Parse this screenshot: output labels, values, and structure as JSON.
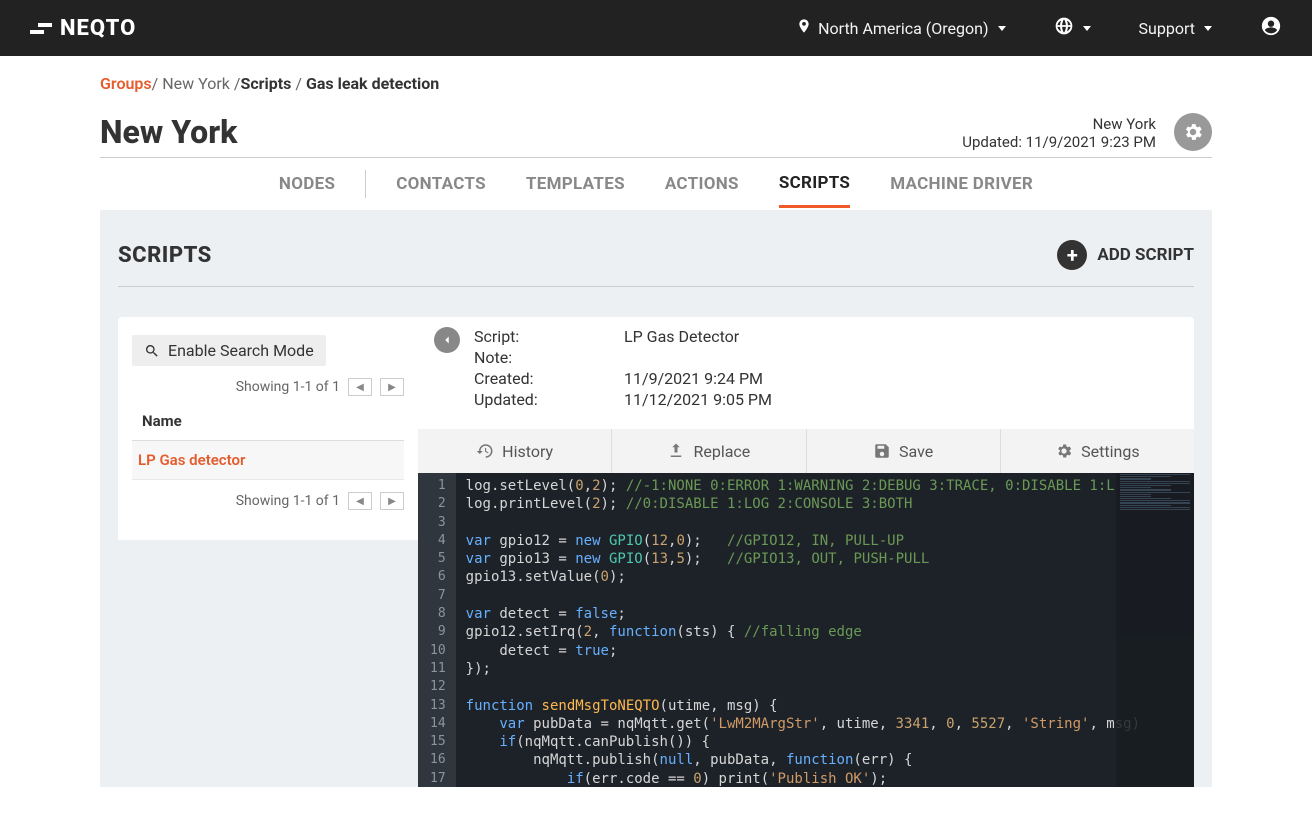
{
  "topbar": {
    "logo": "NEQTO",
    "region": "North America (Oregon)",
    "support": "Support"
  },
  "breadcrumb": {
    "groups": "Groups",
    "group": "New York",
    "scripts": "Scripts",
    "current": "Gas leak detection"
  },
  "header": {
    "title": "New York",
    "meta_name": "New York",
    "meta_updated": "Updated: 11/9/2021 9:23 PM"
  },
  "tabs": {
    "nodes": "NODES",
    "contacts": "CONTACTS",
    "templates": "TEMPLATES",
    "actions": "ACTIONS",
    "scripts": "SCRIPTS",
    "machine_driver": "MACHINE DRIVER"
  },
  "section": {
    "title": "SCRIPTS",
    "add": "ADD SCRIPT"
  },
  "left": {
    "search": "Enable Search Mode",
    "pager_top": "Showing 1-1 of 1",
    "col_name": "Name",
    "item1": "LP Gas detector",
    "pager_bottom": "Showing 1-1 of 1"
  },
  "detail": {
    "k_script": "Script:",
    "v_script": "LP Gas Detector",
    "k_note": "Note:",
    "v_note": "",
    "k_created": "Created:",
    "v_created": "11/9/2021 9:24 PM",
    "k_updated": "Updated:",
    "v_updated": "11/12/2021 9:05 PM"
  },
  "toolbar": {
    "history": "History",
    "replace": "Replace",
    "save": "Save",
    "settings": "Settings"
  },
  "code": {
    "lines": [
      {
        "n": "1",
        "seg": [
          {
            "t": "log.setLevel(",
            "c": "c-plain"
          },
          {
            "t": "0",
            "c": "c-num"
          },
          {
            "t": ",",
            "c": "c-plain"
          },
          {
            "t": "2",
            "c": "c-num"
          },
          {
            "t": "); ",
            "c": "c-plain"
          },
          {
            "t": "//-1:NONE 0:ERROR 1:WARNING 2:DEBUG 3:TRACE, 0:DISABLE 1:L",
            "c": "c-cmt"
          }
        ]
      },
      {
        "n": "2",
        "seg": [
          {
            "t": "log.printLevel(",
            "c": "c-plain"
          },
          {
            "t": "2",
            "c": "c-num"
          },
          {
            "t": "); ",
            "c": "c-plain"
          },
          {
            "t": "//0:DISABLE 1:LOG 2:CONSOLE 3:BOTH",
            "c": "c-cmt"
          }
        ]
      },
      {
        "n": "3",
        "seg": []
      },
      {
        "n": "4",
        "seg": [
          {
            "t": "var",
            "c": "c-kw"
          },
          {
            "t": " gpio12 = ",
            "c": "c-plain"
          },
          {
            "t": "new",
            "c": "c-kw"
          },
          {
            "t": " ",
            "c": "c-plain"
          },
          {
            "t": "GPIO",
            "c": "c-type"
          },
          {
            "t": "(",
            "c": "c-plain"
          },
          {
            "t": "12",
            "c": "c-num"
          },
          {
            "t": ",",
            "c": "c-plain"
          },
          {
            "t": "0",
            "c": "c-num"
          },
          {
            "t": ");   ",
            "c": "c-plain"
          },
          {
            "t": "//GPIO12, IN, PULL-UP",
            "c": "c-cmt"
          }
        ]
      },
      {
        "n": "5",
        "seg": [
          {
            "t": "var",
            "c": "c-kw"
          },
          {
            "t": " gpio13 = ",
            "c": "c-plain"
          },
          {
            "t": "new",
            "c": "c-kw"
          },
          {
            "t": " ",
            "c": "c-plain"
          },
          {
            "t": "GPIO",
            "c": "c-type"
          },
          {
            "t": "(",
            "c": "c-plain"
          },
          {
            "t": "13",
            "c": "c-num"
          },
          {
            "t": ",",
            "c": "c-plain"
          },
          {
            "t": "5",
            "c": "c-num"
          },
          {
            "t": ");   ",
            "c": "c-plain"
          },
          {
            "t": "//GPIO13, OUT, PUSH-PULL",
            "c": "c-cmt"
          }
        ]
      },
      {
        "n": "6",
        "seg": [
          {
            "t": "gpio13.setValue(",
            "c": "c-plain"
          },
          {
            "t": "0",
            "c": "c-num"
          },
          {
            "t": ");",
            "c": "c-plain"
          }
        ]
      },
      {
        "n": "7",
        "seg": []
      },
      {
        "n": "8",
        "seg": [
          {
            "t": "var",
            "c": "c-kw"
          },
          {
            "t": " detect = ",
            "c": "c-plain"
          },
          {
            "t": "false",
            "c": "c-bool"
          },
          {
            "t": ";",
            "c": "c-plain"
          }
        ]
      },
      {
        "n": "9",
        "seg": [
          {
            "t": "gpio12.setIrq(",
            "c": "c-plain"
          },
          {
            "t": "2",
            "c": "c-num"
          },
          {
            "t": ", ",
            "c": "c-plain"
          },
          {
            "t": "function",
            "c": "c-kw"
          },
          {
            "t": "(sts) { ",
            "c": "c-plain"
          },
          {
            "t": "//falling edge",
            "c": "c-cmt"
          }
        ]
      },
      {
        "n": "10",
        "seg": [
          {
            "t": "    detect = ",
            "c": "c-plain"
          },
          {
            "t": "true",
            "c": "c-bool"
          },
          {
            "t": ";",
            "c": "c-plain"
          }
        ]
      },
      {
        "n": "11",
        "seg": [
          {
            "t": "});",
            "c": "c-plain"
          }
        ]
      },
      {
        "n": "12",
        "seg": []
      },
      {
        "n": "13",
        "seg": [
          {
            "t": "function",
            "c": "c-kw"
          },
          {
            "t": " ",
            "c": "c-plain"
          },
          {
            "t": "sendMsgToNEQTO",
            "c": "c-call"
          },
          {
            "t": "(utime, msg) {",
            "c": "c-plain"
          }
        ]
      },
      {
        "n": "14",
        "seg": [
          {
            "t": "    ",
            "c": "c-plain"
          },
          {
            "t": "var",
            "c": "c-kw"
          },
          {
            "t": " pubData = nqMqtt.get(",
            "c": "c-plain"
          },
          {
            "t": "'LwM2MArgStr'",
            "c": "c-str"
          },
          {
            "t": ", utime, ",
            "c": "c-plain"
          },
          {
            "t": "3341",
            "c": "c-num"
          },
          {
            "t": ", ",
            "c": "c-plain"
          },
          {
            "t": "0",
            "c": "c-num"
          },
          {
            "t": ", ",
            "c": "c-plain"
          },
          {
            "t": "5527",
            "c": "c-num"
          },
          {
            "t": ", ",
            "c": "c-plain"
          },
          {
            "t": "'String'",
            "c": "c-str"
          },
          {
            "t": ", msg)",
            "c": "c-plain"
          }
        ]
      },
      {
        "n": "15",
        "seg": [
          {
            "t": "    ",
            "c": "c-plain"
          },
          {
            "t": "if",
            "c": "c-kw"
          },
          {
            "t": "(nqMqtt.canPublish()) {",
            "c": "c-plain"
          }
        ]
      },
      {
        "n": "16",
        "seg": [
          {
            "t": "        nqMqtt.publish(",
            "c": "c-plain"
          },
          {
            "t": "null",
            "c": "c-bool"
          },
          {
            "t": ", pubData, ",
            "c": "c-plain"
          },
          {
            "t": "function",
            "c": "c-kw"
          },
          {
            "t": "(err) {",
            "c": "c-plain"
          }
        ]
      },
      {
        "n": "17",
        "seg": [
          {
            "t": "            ",
            "c": "c-plain"
          },
          {
            "t": "if",
            "c": "c-kw"
          },
          {
            "t": "(err.code == ",
            "c": "c-plain"
          },
          {
            "t": "0",
            "c": "c-num"
          },
          {
            "t": ") print(",
            "c": "c-plain"
          },
          {
            "t": "'Publish OK'",
            "c": "c-str"
          },
          {
            "t": ");",
            "c": "c-plain"
          }
        ]
      }
    ]
  }
}
